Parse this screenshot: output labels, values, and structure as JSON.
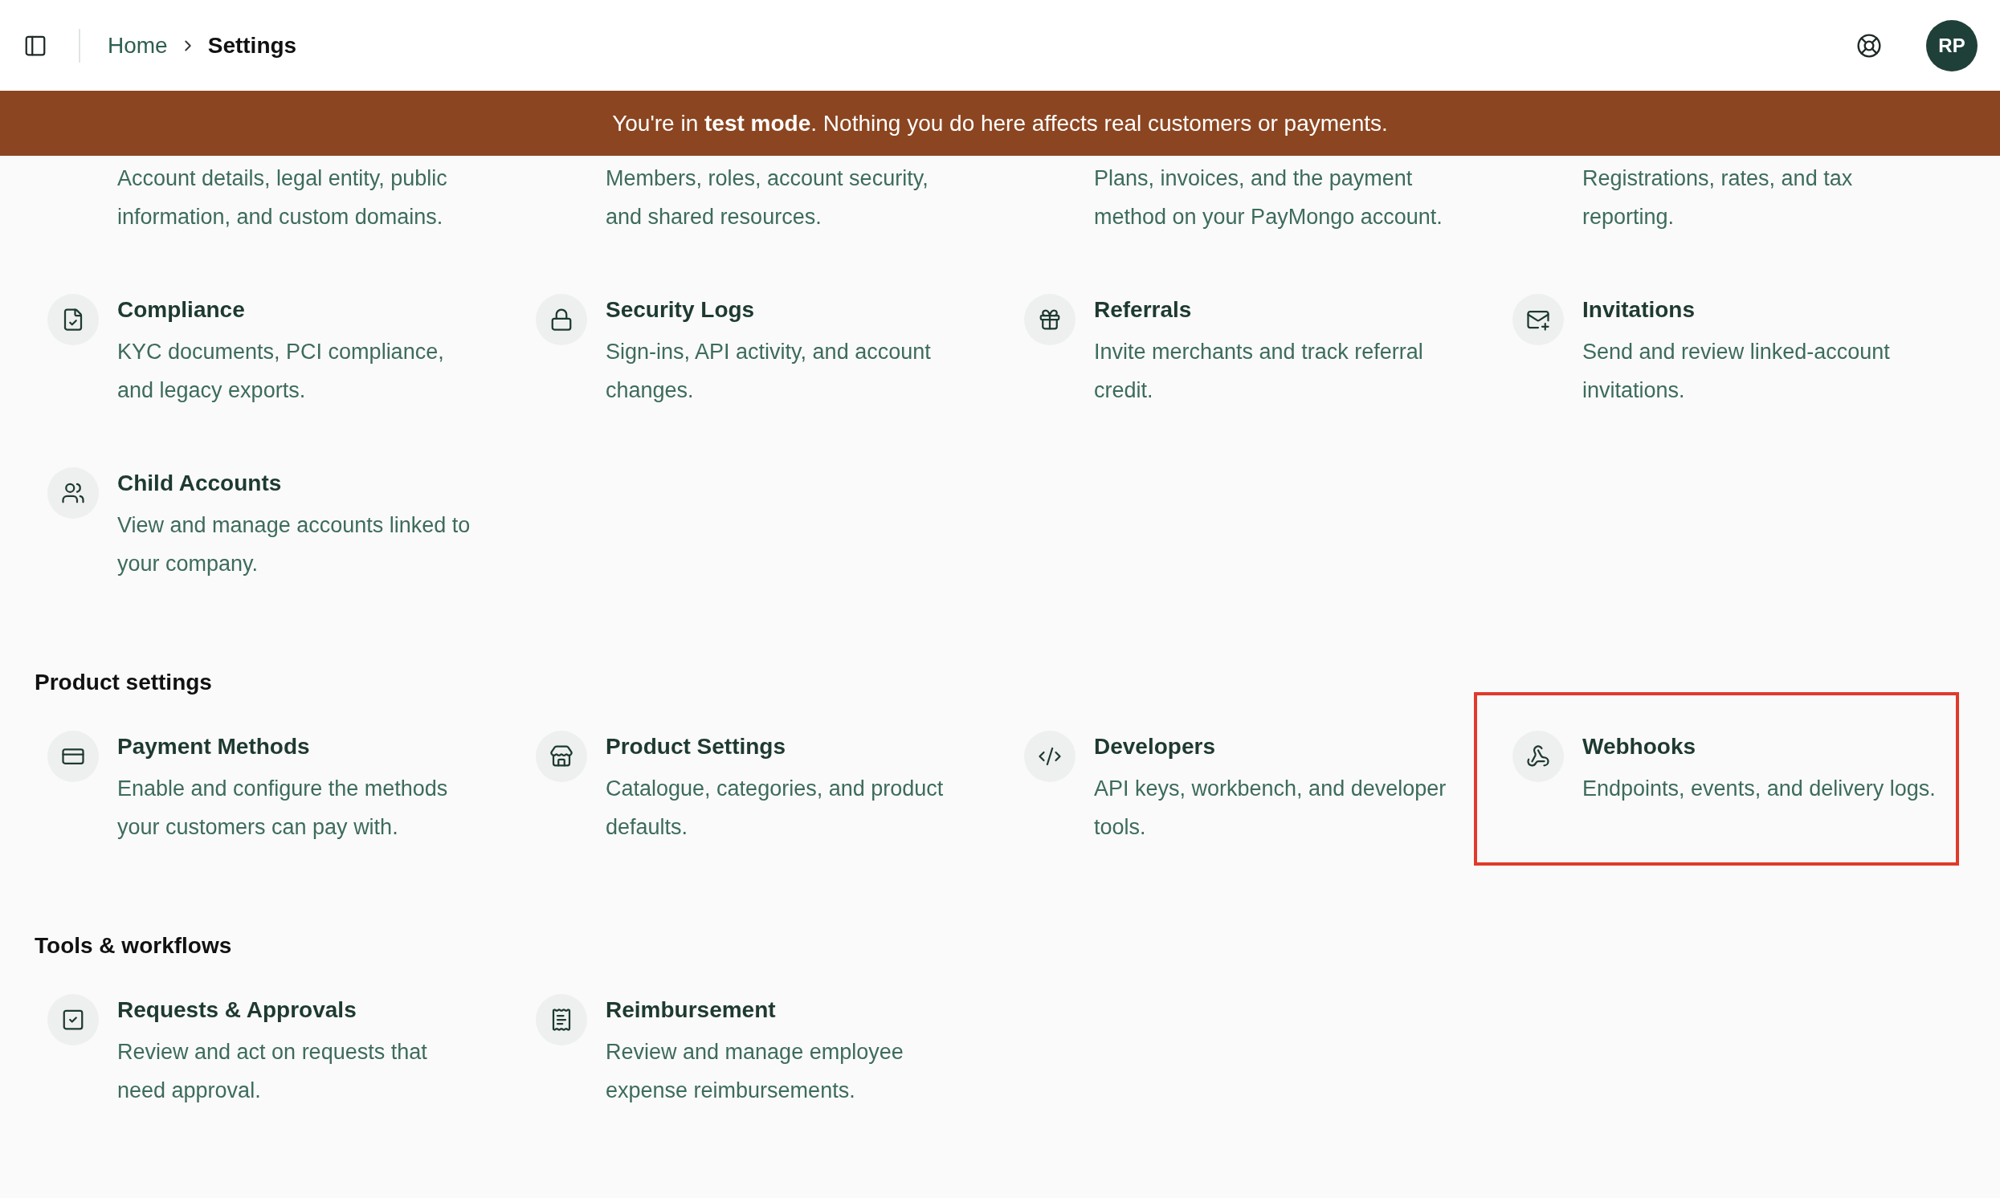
{
  "header": {
    "breadcrumb": [
      {
        "label": "Home",
        "current": false
      },
      {
        "label": "Settings",
        "current": true
      }
    ],
    "avatar": "RP"
  },
  "banner": "You're in **test mode**. Nothing you do here affects real customers or payments.",
  "sections": [
    {
      "items": [
        {
          "description": "Account details, legal entity, public information, and custom domains.",
          "highlighted": false
        },
        {
          "description": "Members, roles, account security, and shared resources.",
          "highlighted": false
        },
        {
          "description": "Plans, invoices, and the payment method on your PayMongo account.",
          "highlighted": false
        },
        {
          "description": "Registrations, rates, and tax reporting.",
          "highlighted": false
        },
        {
          "title": "Compliance",
          "description": "KYC documents, PCI compliance, and legacy exports.",
          "highlighted": false
        },
        {
          "title": "Security Logs",
          "description": "Sign-ins, API activity, and account changes.",
          "highlighted": false
        },
        {
          "title": "Referrals",
          "description": "Invite merchants and track referral credit.",
          "highlighted": false
        },
        {
          "title": "Invitations",
          "description": "Send and review linked-account invitations.",
          "highlighted": false
        },
        {
          "title": "Child Accounts",
          "description": "View and manage accounts linked to your company.",
          "highlighted": false
        }
      ]
    },
    {
      "heading": "Product settings",
      "items": [
        {
          "title": "Payment Methods",
          "description": "Enable and configure the methods your customers can pay with.",
          "highlighted": false
        },
        {
          "title": "Product Settings",
          "description": "Catalogue, categories, and product defaults.",
          "highlighted": false
        },
        {
          "title": "Developers",
          "description": "API keys, workbench, and developer tools.",
          "highlighted": false
        },
        {
          "title": "Webhooks",
          "description": "Endpoints, events, and delivery logs.",
          "highlighted": true
        }
      ]
    },
    {
      "heading": "Tools & workflows",
      "items": [
        {
          "title": "Requests & Approvals",
          "description": "Review and act on requests that need approval.",
          "highlighted": false
        },
        {
          "title": "Reimbursement",
          "description": "Review and manage employee expense reimbursements.",
          "highlighted": false
        }
      ]
    }
  ]
}
